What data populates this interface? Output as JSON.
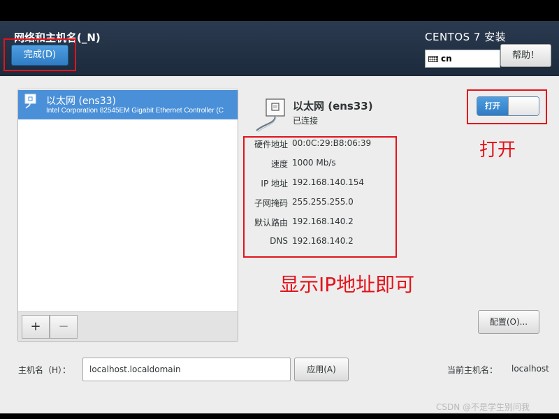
{
  "header": {
    "page_title": "网络和主机名(_N)",
    "done_label": "完成(D)",
    "product_title": "CENTOS 7 安装",
    "keyboard_layout": "cn",
    "help_label": "帮助！"
  },
  "device_list": {
    "items": [
      {
        "title": "以太网 (ens33)",
        "subtitle": "Intel Corporation 82545EM Gigabit Ethernet Controller (C"
      }
    ],
    "add_label": "+",
    "remove_label": "−"
  },
  "detail": {
    "device_name": "以太网 (ens33)",
    "status": "已连接",
    "toggle_label": "打开",
    "toggle_on": true,
    "rows": [
      {
        "label": "硬件地址",
        "value": "00:0C:29:B8:06:39"
      },
      {
        "label": "速度",
        "value": "1000 Mb/s"
      },
      {
        "label": "IP 地址",
        "value": "192.168.140.154"
      },
      {
        "label": "子网掩码",
        "value": "255.255.255.0"
      },
      {
        "label": "默认路由",
        "value": "192.168.140.2"
      },
      {
        "label": "DNS",
        "value": "192.168.140.2"
      }
    ],
    "config_label": "配置(O)..."
  },
  "hostname": {
    "label": "主机名（H）：",
    "value": "localhost.localdomain",
    "apply_label": "应用(A)",
    "current_label": "当前主机名：",
    "current_value": "localhost"
  },
  "annotations": {
    "toggle_note": "打开",
    "ip_note": "显示IP地址即可",
    "color": "#e2131b"
  },
  "watermark": "CSDN @不是学生别问我",
  "colors": {
    "accent": "#4a90d9",
    "header": "#1c2a3c"
  }
}
